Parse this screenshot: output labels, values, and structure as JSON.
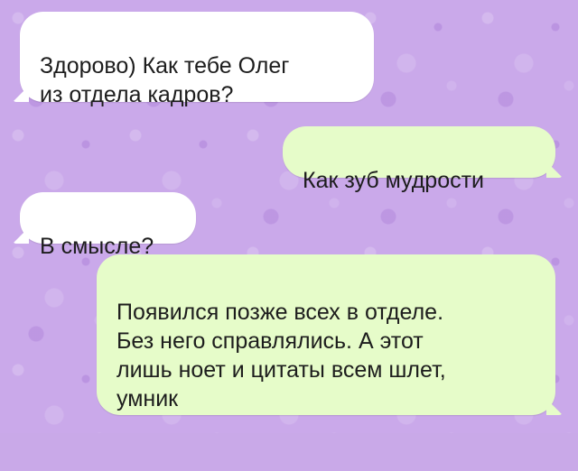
{
  "chat": {
    "background_color": "#caa9ea",
    "incoming_color": "#ffffff",
    "outgoing_color": "#e6fcc9",
    "messages": [
      {
        "direction": "incoming",
        "text": "Здорово) Как тебе Олег\nиз отдела кадров?"
      },
      {
        "direction": "outgoing",
        "text": "Как зуб мудрости"
      },
      {
        "direction": "incoming",
        "text": "В смысле?"
      },
      {
        "direction": "outgoing",
        "text": "Появился позже всех в отделе.\nБез него справлялись. А этот\nлишь ноет и цитаты всем шлет,\nумник"
      }
    ]
  }
}
